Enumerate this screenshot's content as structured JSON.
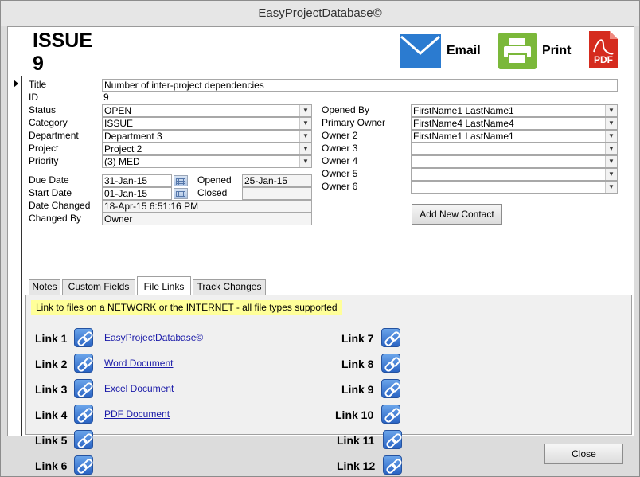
{
  "window": {
    "title": "EasyProjectDatabase©"
  },
  "header": {
    "issue_title_line1": "ISSUE",
    "issue_title_line2": "9",
    "email_label": "Email",
    "print_label": "Print",
    "pdf_icon_text": "PDF",
    "email_icon_color": "#2b7bd0",
    "print_icon_color": "#7bb83a",
    "pdf_icon_color": "#d52b1e"
  },
  "fields": {
    "title_label": "Title",
    "title_value": "Number of inter-project dependencies",
    "id_label": "ID",
    "id_value": "9",
    "status_label": "Status",
    "status_value": "OPEN",
    "category_label": "Category",
    "category_value": "ISSUE",
    "department_label": "Department",
    "department_value": "Department 3",
    "project_label": "Project",
    "project_value": "Project 2",
    "priority_label": "Priority",
    "priority_value": "(3) MED",
    "due_date_label": "Due Date",
    "due_date_value": "31-Jan-15",
    "start_date_label": "Start Date",
    "start_date_value": "01-Jan-15",
    "opened_label": "Opened",
    "opened_value": "25-Jan-15",
    "closed_label": "Closed",
    "closed_value": "",
    "date_changed_label": "Date Changed",
    "date_changed_value": "18-Apr-15 6:51:16 PM",
    "changed_by_label": "Changed By",
    "changed_by_value": "Owner"
  },
  "owners": {
    "opened_by_label": "Opened By",
    "opened_by_value": "FirstName1 LastName1",
    "primary_owner_label": "Primary Owner",
    "primary_owner_value": "FirstName4 LastName4",
    "owner2_label": "Owner 2",
    "owner2_value": "FirstName1 LastName1",
    "owner3_label": "Owner 3",
    "owner3_value": "",
    "owner4_label": "Owner 4",
    "owner4_value": "",
    "owner5_label": "Owner 5",
    "owner5_value": "",
    "owner6_label": "Owner 6",
    "owner6_value": "",
    "add_contact_label": "Add New Contact"
  },
  "tabs": {
    "notes": "Notes",
    "custom_fields": "Custom Fields",
    "file_links": "File Links",
    "track_changes": "Track Changes",
    "active": "File Links"
  },
  "file_links": {
    "banner": "Link to files on a NETWORK or the INTERNET - all file types supported",
    "banner_color": "#ffff99",
    "links": [
      {
        "label": "Link 1",
        "target": "EasyProjectDatabase©"
      },
      {
        "label": "Link 2",
        "target": "Word Document"
      },
      {
        "label": "Link 3",
        "target": "Excel Document"
      },
      {
        "label": "Link 4",
        "target": "PDF Document"
      },
      {
        "label": "Link 5",
        "target": ""
      },
      {
        "label": "Link 6",
        "target": ""
      },
      {
        "label": "Link 7",
        "target": ""
      },
      {
        "label": "Link 8",
        "target": ""
      },
      {
        "label": "Link 9",
        "target": ""
      },
      {
        "label": "Link 10",
        "target": ""
      },
      {
        "label": "Link 11",
        "target": ""
      },
      {
        "label": "Link 12",
        "target": ""
      }
    ]
  },
  "footer": {
    "close_label": "Close"
  }
}
